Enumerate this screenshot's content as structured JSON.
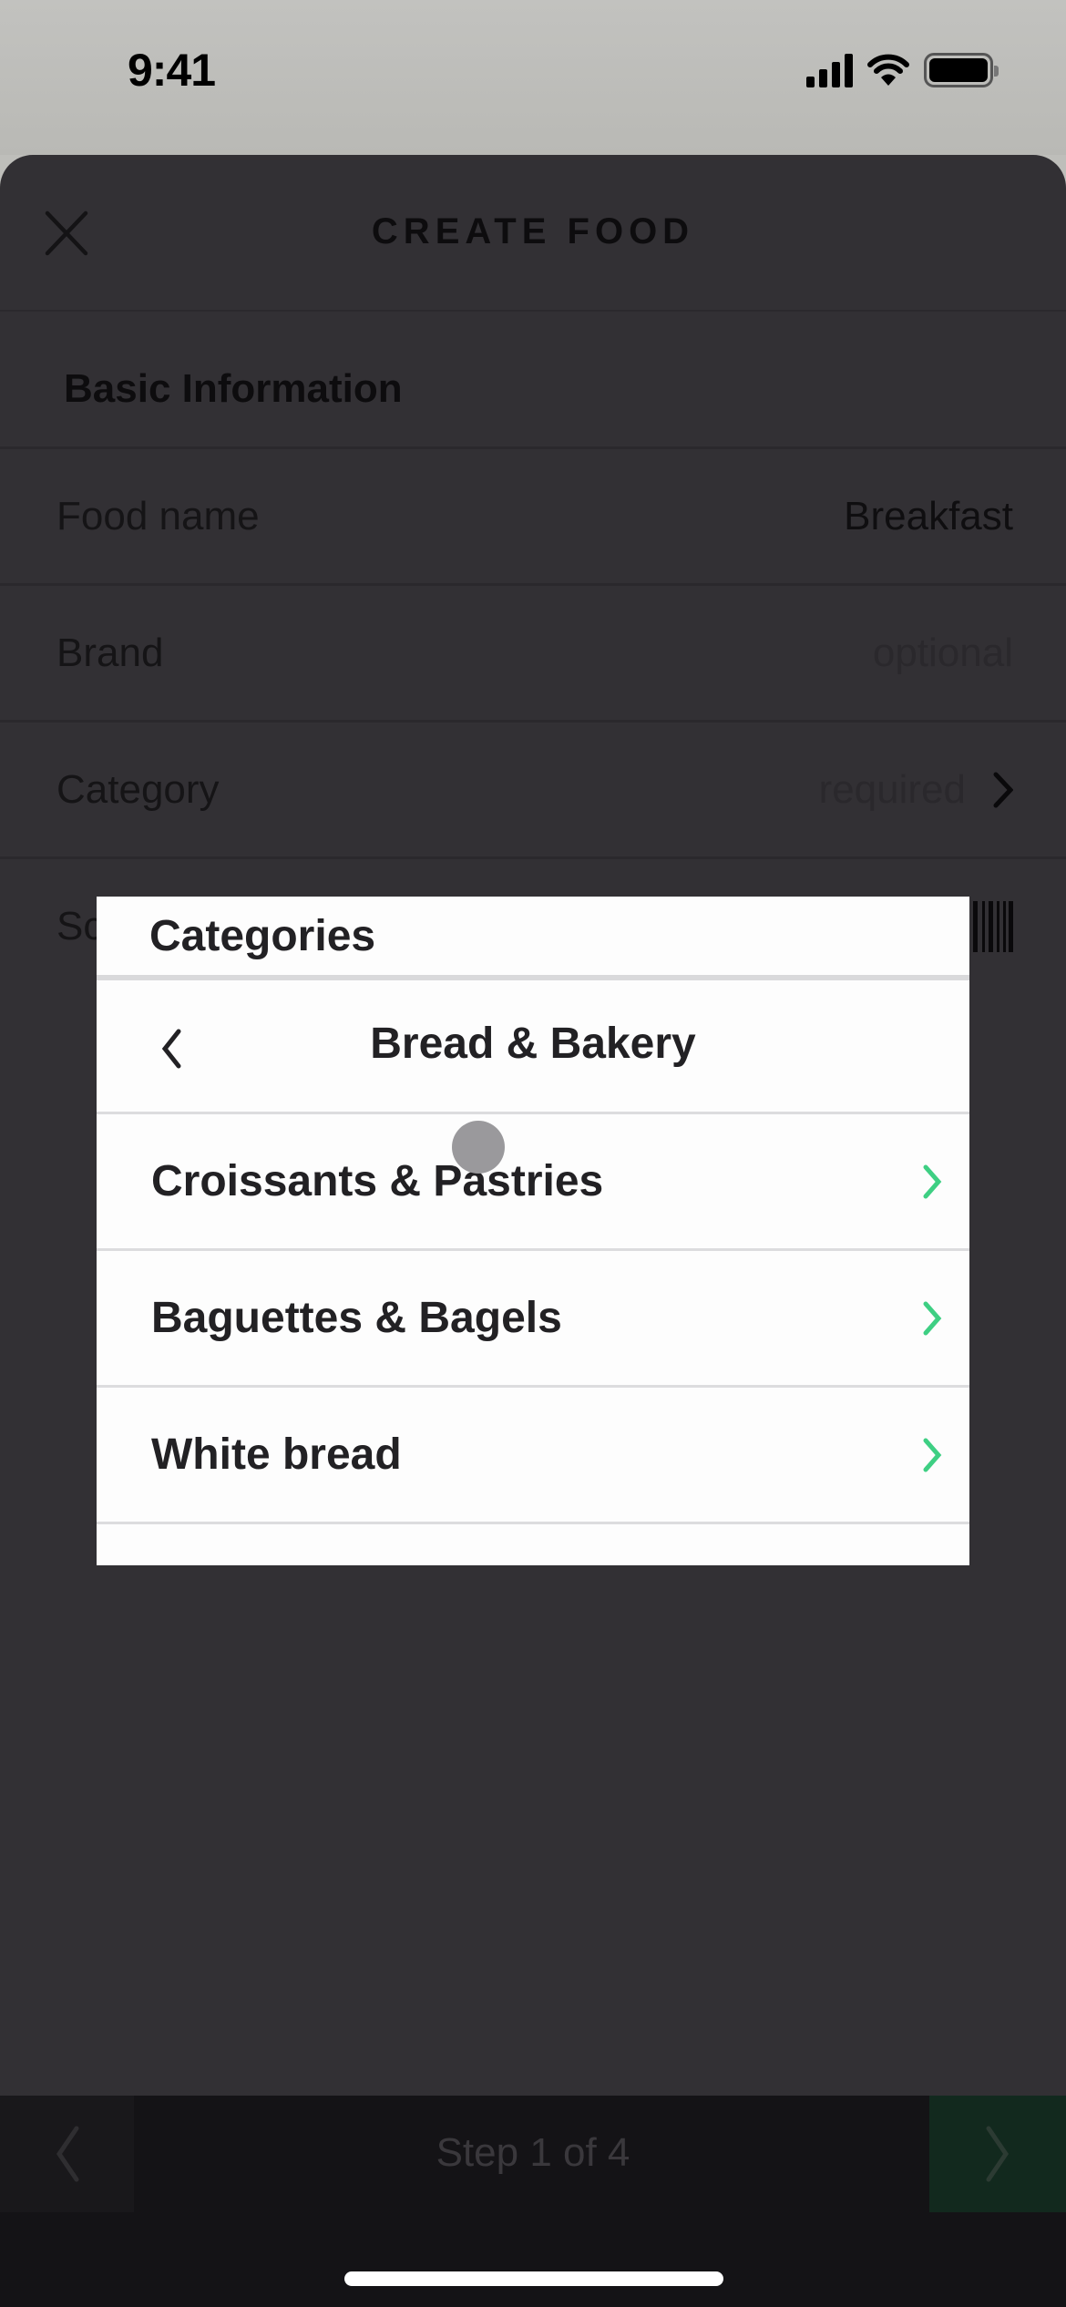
{
  "status_bar": {
    "time": "9:41",
    "icons": [
      "cellular-signal-icon",
      "wifi-icon",
      "battery-icon"
    ]
  },
  "header": {
    "title": "CREATE FOOD",
    "close_icon": "close-icon"
  },
  "form": {
    "section_title": "Basic Information",
    "rows": [
      {
        "label": "Food name",
        "value": "Breakfast"
      },
      {
        "label": "Brand",
        "placeholder": "optional"
      },
      {
        "label": "Category",
        "placeholder": "required",
        "icon": "chevron-right-icon"
      },
      {
        "label": "Sc",
        "icon": "barcode-icon"
      }
    ]
  },
  "modal": {
    "title": "Categories",
    "current_category": "Bread & Bakery",
    "back_icon": "chevron-left-icon",
    "items": [
      {
        "label": "Croissants & Pastries",
        "icon": "chevron-right-icon"
      },
      {
        "label": "Baguettes & Bagels",
        "icon": "chevron-right-icon"
      },
      {
        "label": "White bread",
        "icon": "chevron-right-icon"
      }
    ],
    "accent_color": "#3ecf83"
  },
  "footer": {
    "step_label": "Step 1 of 4",
    "current_step": 1,
    "total_steps": 4,
    "prev_icon": "chevron-left-icon",
    "next_icon": "chevron-right-icon"
  }
}
